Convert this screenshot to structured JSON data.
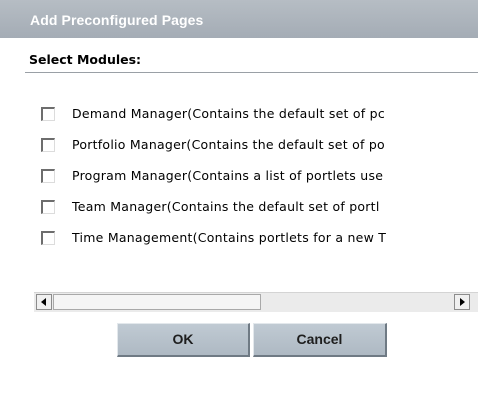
{
  "dialog": {
    "title": "Add Preconfigured Pages",
    "section_label": "Select Modules:",
    "modules": [
      {
        "label": "Demand Manager(Contains the default set of pc",
        "checked": false
      },
      {
        "label": "Portfolio Manager(Contains the default set of po",
        "checked": false
      },
      {
        "label": "Program Manager(Contains a list of portlets use",
        "checked": false
      },
      {
        "label": "Team Manager(Contains the default set of portl",
        "checked": false
      },
      {
        "label": "Time Management(Contains portlets for a new T",
        "checked": false
      }
    ],
    "buttons": {
      "ok_label": "OK",
      "cancel_label": "Cancel"
    }
  },
  "colors": {
    "title_bar": "#a9b1ba",
    "title_text": "#ffffff",
    "button_face": "#b7c1cb"
  },
  "icons": {
    "scroll_left": "left-arrow-icon",
    "scroll_right": "right-arrow-icon"
  }
}
